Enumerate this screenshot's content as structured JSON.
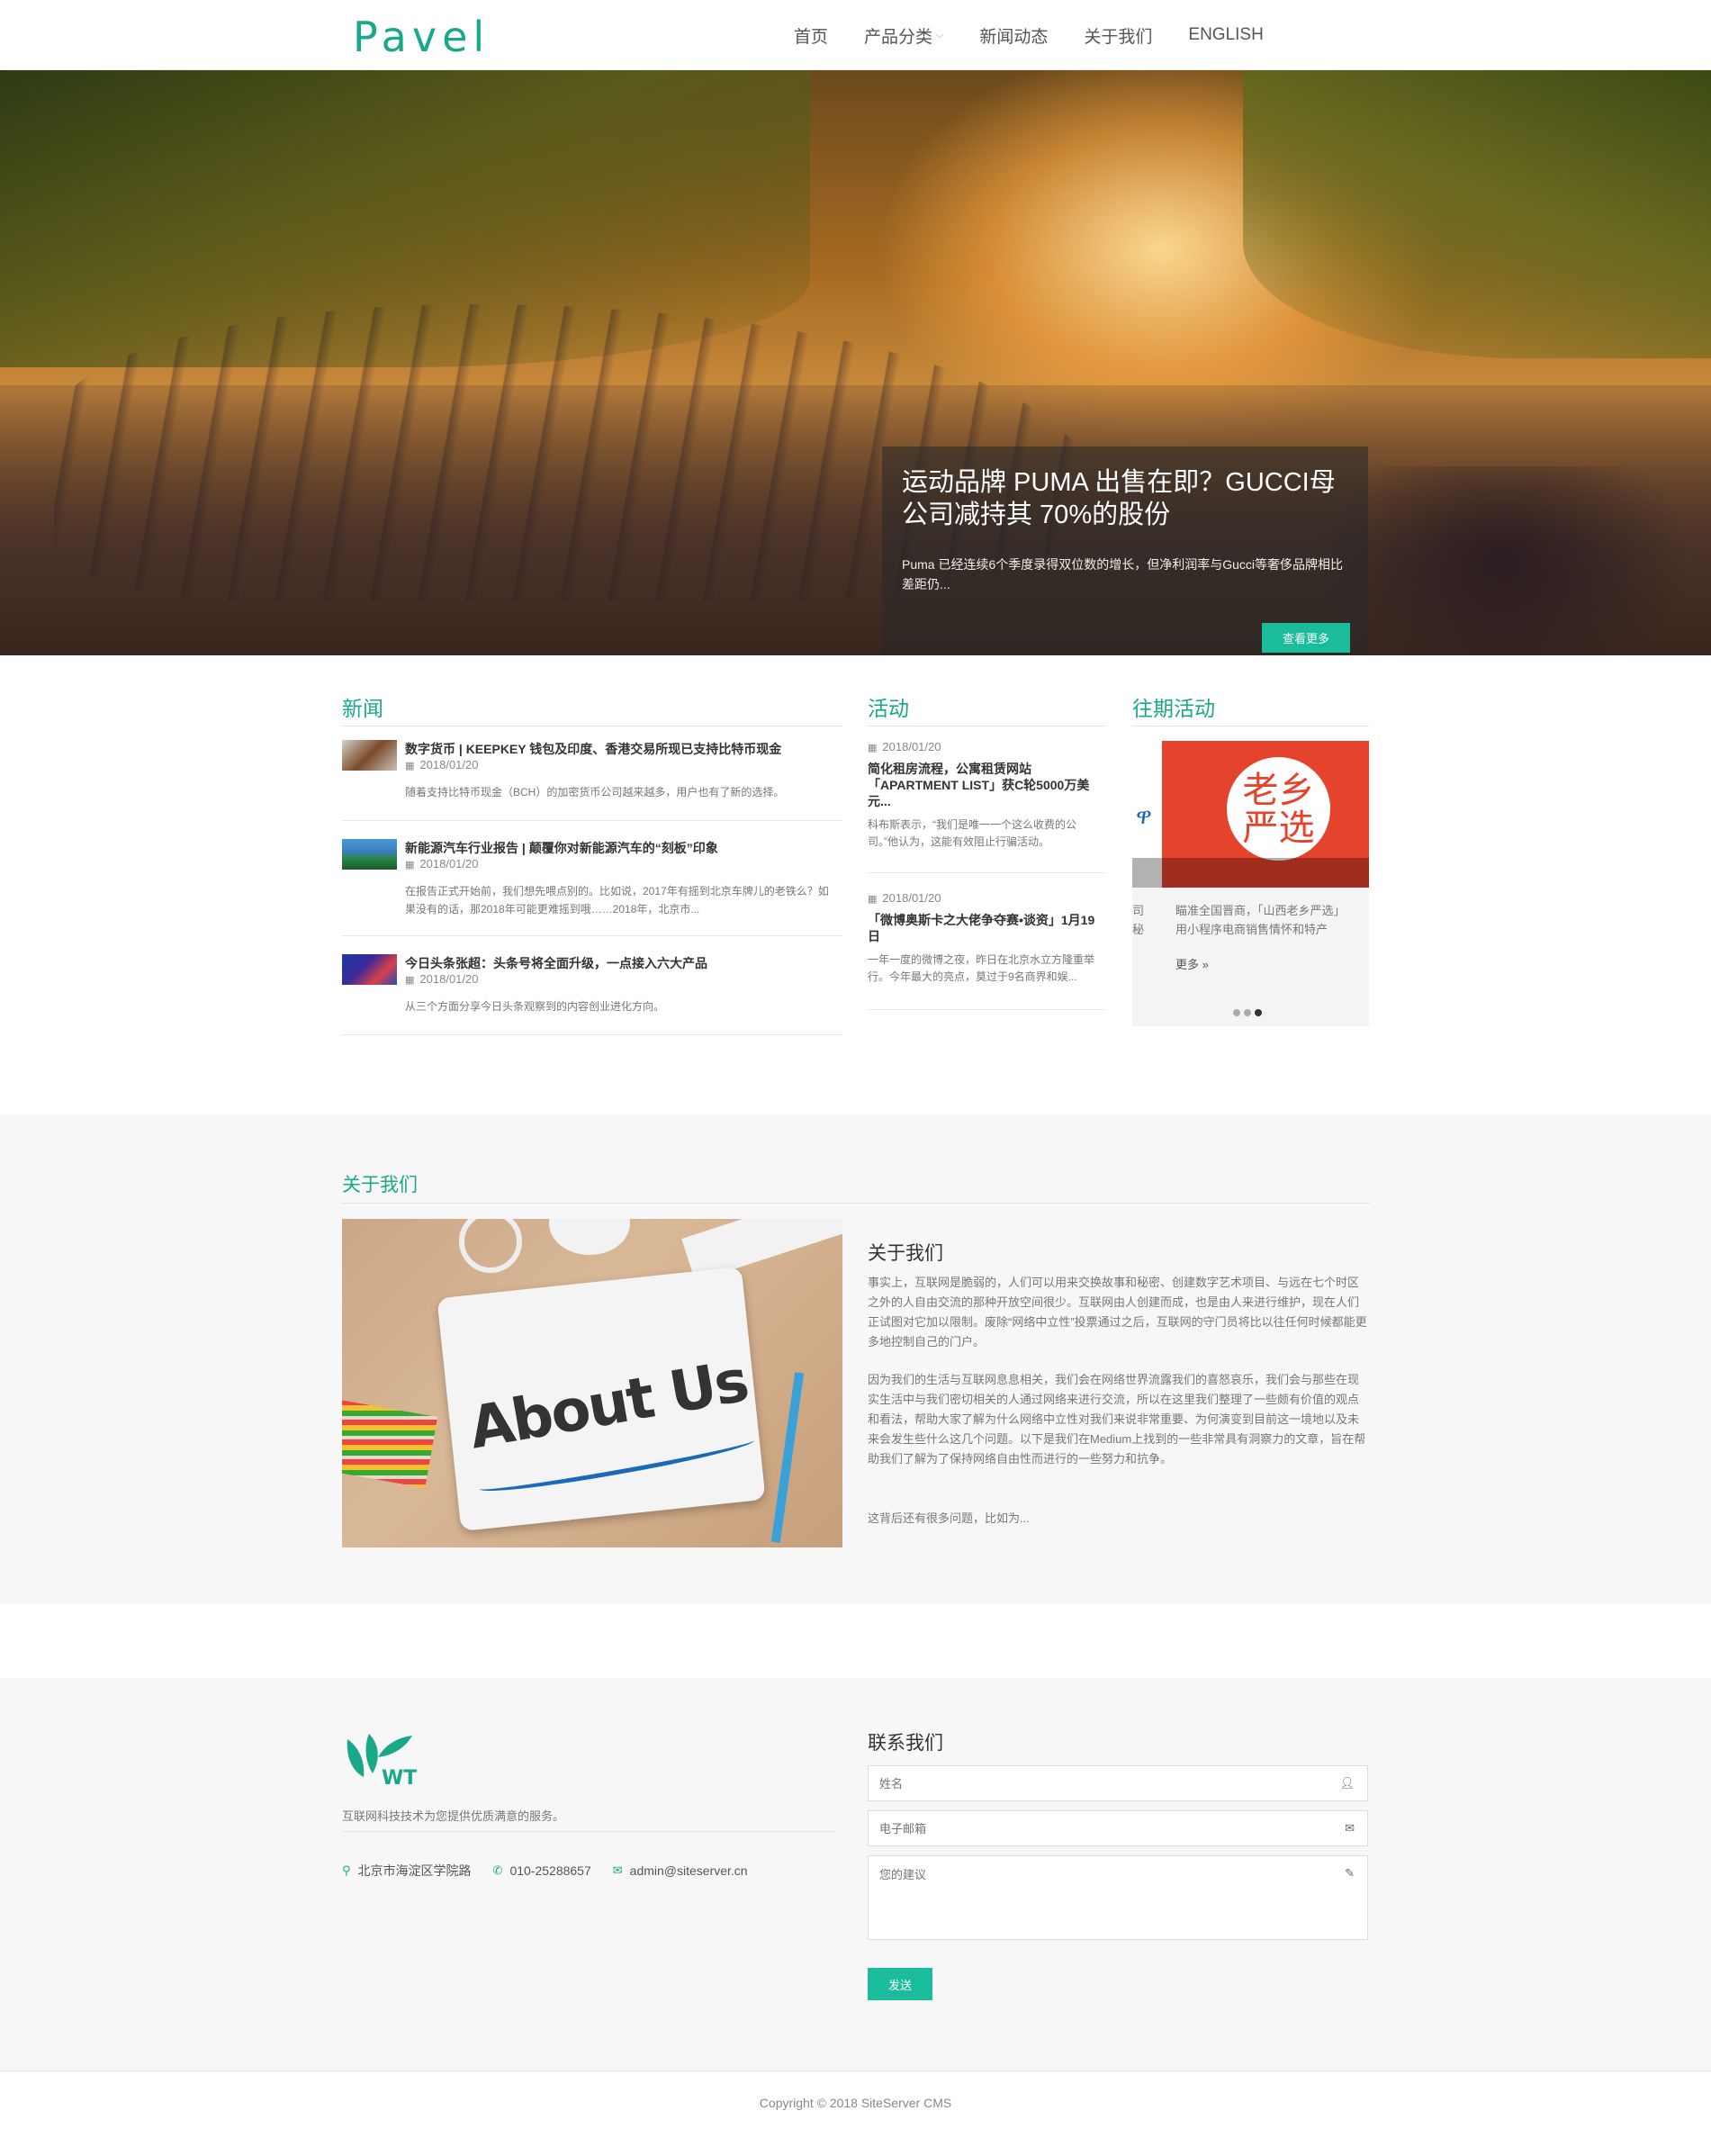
{
  "header": {
    "logo_text": "Pavel",
    "nav": [
      {
        "label": "首页"
      },
      {
        "label": "产品分类",
        "has_dropdown": true
      },
      {
        "label": "新闻动态"
      },
      {
        "label": "关于我们"
      },
      {
        "label": "ENGLISH"
      }
    ]
  },
  "hero": {
    "title": "运动品牌 PUMA 出售在即？GUCCI母公司减持其 70%的股份",
    "desc": "Puma 已经连续6个季度录得双位数的增长，但净利润率与Gucci等奢侈品牌相比差距仍...",
    "button": "查看更多"
  },
  "news": {
    "title": "新闻",
    "items": [
      {
        "title": "数字货币 | KEEPKEY 钱包及印度、香港交易所现已支持比特币现金",
        "date": "2018/01/20",
        "desc": "随着支持比特币现金（BCH）的加密货币公司越来越多，用户也有了新的选择。"
      },
      {
        "title": "新能源汽车行业报告 | 颠覆你对新能源汽车的“刻板”印象",
        "date": "2018/01/20",
        "desc": "在报告正式开始前，我们想先喂点别的。比如说，2017年有摇到北京车牌儿的老铁么？如果没有的话，那2018年可能更难摇到哦……2018年，北京市..."
      },
      {
        "title": "今日头条张超：头条号将全面升级，一点接入六大产品",
        "date": "2018/01/20",
        "desc": "从三个方面分享今日头条观察到的内容创业进化方向。"
      }
    ]
  },
  "activity": {
    "title": "活动",
    "items": [
      {
        "date": "2018/01/20",
        "title": "简化租房流程，公寓租赁网站「APARTMENT LIST」获C轮5000万美元...",
        "desc": "科布斯表示，“我们是唯一一个这么收费的公司。”他认为，这能有效阻止行骗活动。"
      },
      {
        "date": "2018/01/20",
        "title": "「微博奥斯卡之大佬争夺赛•谈资」1月19日",
        "desc": "一年一度的微博之夜，昨日在北京水立方隆重举行。今年最大的亮点，莫过于9名商界和娱..."
      }
    ]
  },
  "past": {
    "title": "往期活动",
    "img_text": "老乡严选",
    "desc_line1": "瞄准全国晋商，「山西老乡严选」",
    "desc_line2": "用小程序电商销售情怀和特产",
    "side_line1": "司",
    "side_line2": "秘",
    "more": "更多 »",
    "dots": 3,
    "active_dot": 2
  },
  "about": {
    "section_title": "关于我们",
    "heading": "关于我们",
    "img_text": "About Us",
    "paragraphs": [
      "事实上，互联网是脆弱的，人们可以用来交换故事和秘密、创建数字艺术项目、与远在七个时区之外的人自由交流的那种开放空间很少。互联网由人创建而成，也是由人来进行维护，现在人们正试图对它加以限制。废除“网络中立性”投票通过之后，互联网的守门员将比以往任何时候都能更多地控制自己的门户。",
      "因为我们的生活与互联网息息相关，我们会在网络世界流露我们的喜怒哀乐，我们会与那些在现实生活中与我们密切相关的人通过网络来进行交流，所以在这里我们整理了一些颇有价值的观点和看法，帮助大家了解为什么网络中立性对我们来说非常重要、为何演变到目前这一境地以及未来会发生些什么这几个问题。以下是我们在Medium上找到的一些非常具有洞察力的文章，旨在帮助我们了解为了保持网络自由性而进行的一些努力和抗争。",
      "这背后还有很多问题，比如为..."
    ]
  },
  "footer": {
    "logo_text": "WT",
    "desc": "互联网科技技术为您提供优质满意的服务。",
    "address": "北京市海淀区学院路",
    "phone": "010-25288657",
    "email": "admin@siteserver.cn",
    "contact_title": "联系我们",
    "name_placeholder": "姓名",
    "email_placeholder": "电子邮箱",
    "message_placeholder": "您的建议",
    "send": "发送",
    "copyright": "Copyright © 2018 SiteServer CMS"
  },
  "colors": {
    "accent": "#1abc9c",
    "title_green": "#1aa88a",
    "past_red": "#e6432c"
  }
}
